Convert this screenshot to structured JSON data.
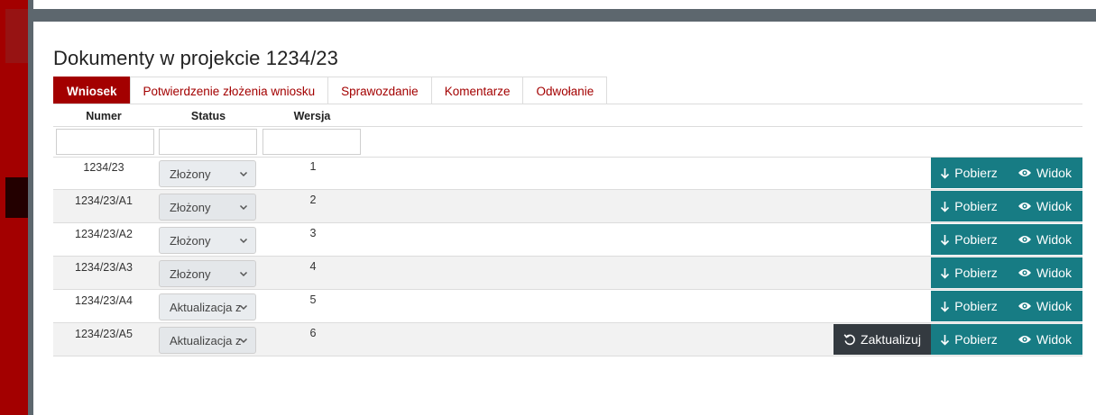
{
  "page_title": "Dokumenty w projekcie 1234/23",
  "tabs": [
    {
      "label": "Wniosek",
      "active": true
    },
    {
      "label": "Potwierdzenie złożenia wniosku",
      "active": false
    },
    {
      "label": "Sprawozdanie",
      "active": false
    },
    {
      "label": "Komentarze",
      "active": false
    },
    {
      "label": "Odwołanie",
      "active": false
    }
  ],
  "columns": {
    "numer": "Numer",
    "status": "Status",
    "wersja": "Wersja"
  },
  "filters": {
    "numer": "",
    "status": "",
    "wersja": ""
  },
  "actions": {
    "pobierz": "Pobierz",
    "widok": "Widok",
    "zaktualizuj": "Zaktualizuj"
  },
  "rows": [
    {
      "numer": "1234/23",
      "status": "Złożony",
      "wersja": "1"
    },
    {
      "numer": "1234/23/A1",
      "status": "Złożony",
      "wersja": "2"
    },
    {
      "numer": "1234/23/A2",
      "status": "Złożony",
      "wersja": "3"
    },
    {
      "numer": "1234/23/A3",
      "status": "Złożony",
      "wersja": "4"
    },
    {
      "numer": "1234/23/A4",
      "status": "Aktualizacja z",
      "wersja": "5"
    },
    {
      "numer": "1234/23/A5",
      "status": "Aktualizacja z",
      "wersja": "6"
    }
  ],
  "colors": {
    "brand": "#a30000",
    "teal": "#177c84",
    "dark": "#343a40",
    "chrome": "#5d676e"
  },
  "icons": {
    "download": "arrow-down-icon",
    "view": "eye-icon",
    "update": "undo-icon",
    "dropdown": "chevron-down-icon"
  }
}
